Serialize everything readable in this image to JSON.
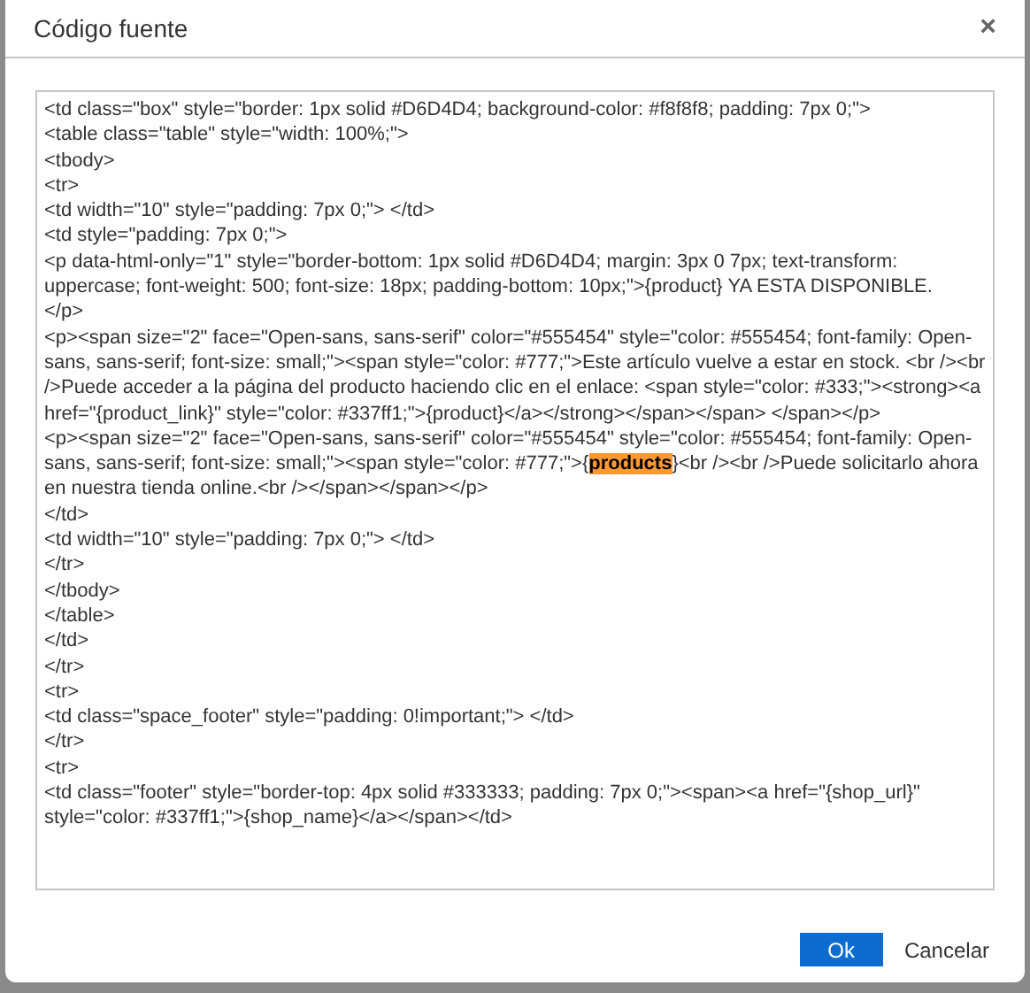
{
  "dialog": {
    "title": "Código fuente",
    "close": "×"
  },
  "code_lines": [
    {
      "segments": [
        {
          "text": "<td class=\"box\" style=\"border: 1px solid #D6D4D4; background-color: #f8f8f8; padding: 7px 0;\">",
          "highlighted": false
        }
      ]
    },
    {
      "segments": [
        {
          "text": "<table class=\"table\" style=\"width: 100%;\">",
          "highlighted": false
        }
      ]
    },
    {
      "segments": [
        {
          "text": "<tbody>",
          "highlighted": false
        }
      ]
    },
    {
      "segments": [
        {
          "text": "<tr>",
          "highlighted": false
        }
      ]
    },
    {
      "segments": [
        {
          "text": "<td width=\"10\" style=\"padding: 7px 0;\"> </td>",
          "highlighted": false
        }
      ]
    },
    {
      "segments": [
        {
          "text": "<td style=\"padding: 7px 0;\">",
          "highlighted": false
        }
      ]
    },
    {
      "segments": [
        {
          "text": "<p data-html-only=\"1\" style=\"border-bottom: 1px solid #D6D4D4; margin: 3px 0 7px; text-transform: uppercase; font-weight: 500; font-size: 18px; padding-bottom: 10px;\">{product} YA ESTA DISPONIBLE.",
          "highlighted": false
        }
      ]
    },
    {
      "segments": [
        {
          "text": "</p>",
          "highlighted": false
        }
      ]
    },
    {
      "segments": [
        {
          "text": "<p><span size=\"2\" face=\"Open-sans, sans-serif\" color=\"#555454\" style=\"color: #555454; font-family: Open-sans, sans-serif; font-size: small;\"><span style=\"color: #777;\">Este artículo vuelve a estar en stock. <br /><br />Puede acceder a la página del producto haciendo clic en el enlace: <span style=\"color: #333;\"><strong><a href=\"{product_link}\" style=\"color: #337ff1;\">{product}</a></strong></span></span> </span></p>",
          "highlighted": false
        }
      ]
    },
    {
      "segments": [
        {
          "text": "<p><span size=\"2\" face=\"Open-sans, sans-serif\" color=\"#555454\" style=\"color: #555454; font-family: Open-sans, sans-serif; font-size: small;\"><span style=\"color: #777;\">{",
          "highlighted": false
        },
        {
          "text": "products",
          "highlighted": true
        },
        {
          "text": "}<br /><br />Puede solicitarlo ahora en nuestra tienda online.<br /></span></span></p>",
          "highlighted": false
        }
      ]
    },
    {
      "segments": [
        {
          "text": "</td>",
          "highlighted": false
        }
      ]
    },
    {
      "segments": [
        {
          "text": "<td width=\"10\" style=\"padding: 7px 0;\"> </td>",
          "highlighted": false
        }
      ]
    },
    {
      "segments": [
        {
          "text": "</tr>",
          "highlighted": false
        }
      ]
    },
    {
      "segments": [
        {
          "text": "</tbody>",
          "highlighted": false
        }
      ]
    },
    {
      "segments": [
        {
          "text": "</table>",
          "highlighted": false
        }
      ]
    },
    {
      "segments": [
        {
          "text": "</td>",
          "highlighted": false
        }
      ]
    },
    {
      "segments": [
        {
          "text": "</tr>",
          "highlighted": false
        }
      ]
    },
    {
      "segments": [
        {
          "text": "<tr>",
          "highlighted": false
        }
      ]
    },
    {
      "segments": [
        {
          "text": "<td class=\"space_footer\" style=\"padding: 0!important;\"> </td>",
          "highlighted": false
        }
      ]
    },
    {
      "segments": [
        {
          "text": "</tr>",
          "highlighted": false
        }
      ]
    },
    {
      "segments": [
        {
          "text": "<tr>",
          "highlighted": false
        }
      ]
    },
    {
      "segments": [
        {
          "text": "<td class=\"footer\" style=\"border-top: 4px solid #333333; padding: 7px 0;\"><span><a href=\"{shop_url}\" style=\"color: #337ff1;\">{shop_name}</a></span></td>",
          "highlighted": false
        }
      ]
    }
  ],
  "buttons": [
    {
      "label": "Ok",
      "kind": "primary"
    },
    {
      "label": "Cancelar",
      "kind": "secondary"
    }
  ]
}
